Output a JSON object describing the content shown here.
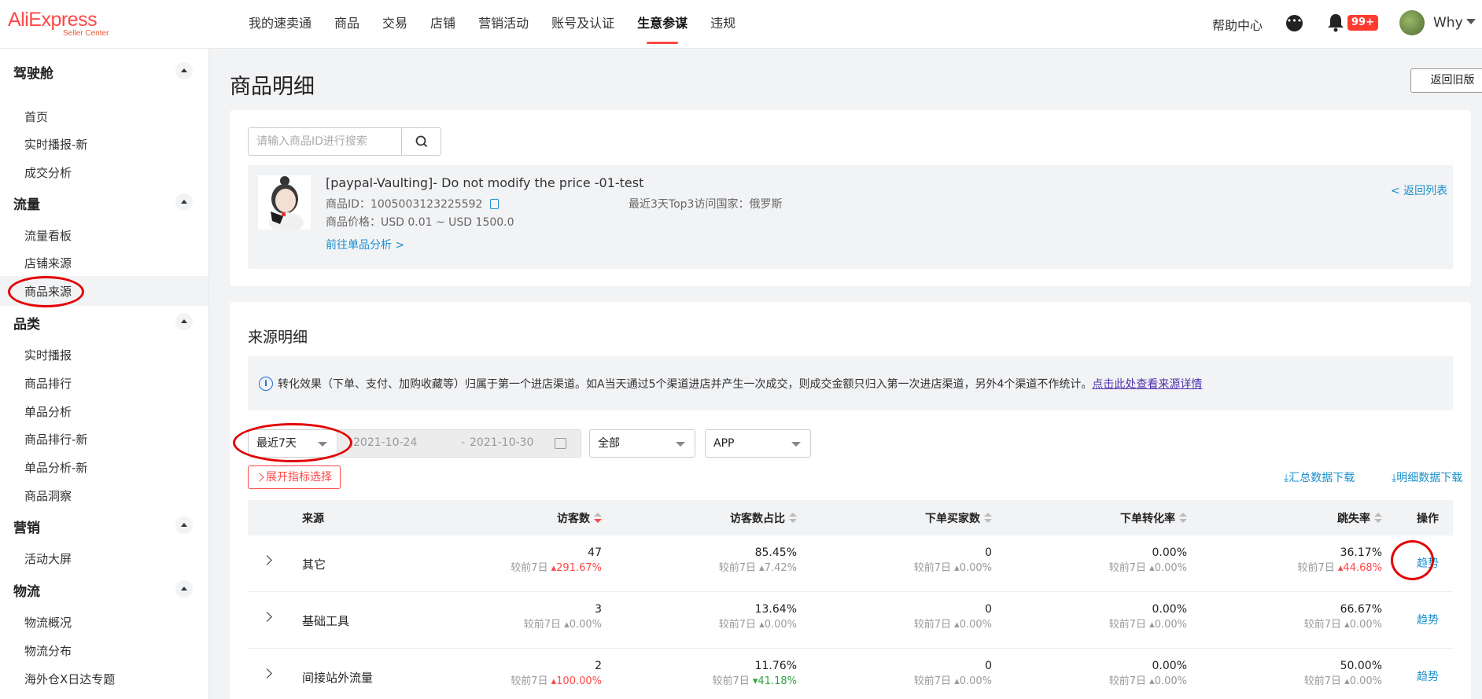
{
  "app": {
    "brand": "AliExpress",
    "sub": "Seller Center"
  },
  "nav": [
    "我的速卖通",
    "商品",
    "交易",
    "店铺",
    "营销活动",
    "账号及认证",
    "生意参谋",
    "违规"
  ],
  "nav_active": "生意参谋",
  "header": {
    "help": "帮助中心",
    "badge": "99+",
    "user": "Why"
  },
  "sidebar": {
    "sections": [
      {
        "title": "驾驶舱",
        "items": [
          "首页",
          "实时播报-新",
          "成交分析"
        ]
      },
      {
        "title": "流量",
        "items": [
          "流量看板",
          "店铺来源",
          "商品来源"
        ]
      },
      {
        "title": "品类",
        "items": [
          "实时播报",
          "商品排行",
          "单品分析",
          "商品排行-新",
          "单品分析-新",
          "商品洞察"
        ]
      },
      {
        "title": "营销",
        "items": [
          "活动大屏"
        ]
      },
      {
        "title": "物流",
        "items": [
          "物流概况",
          "物流分布",
          "海外仓X日达专题"
        ]
      }
    ],
    "selected": "商品来源"
  },
  "page": {
    "title": "商品明细",
    "old_version": "返回旧版"
  },
  "search": {
    "placeholder": "请输入商品ID进行搜索"
  },
  "product": {
    "name": "[paypal-Vaulting]- Do not modify the price -01-test",
    "id": "商品ID：1005003123225592",
    "price": "商品价格：USD 0.01 ~ USD 1500.0",
    "link": "前往单品分析 >",
    "top_countries": "最近3天Top3访问国家：俄罗斯",
    "back": "< 返回列表"
  },
  "source": {
    "title": "来源明细",
    "notice_text": "转化效果（下单、支付、加购收藏等）归属于第一个进店渠道。如A当天通过5个渠道进店并产生一次成交，则成交金额只归入第一次进店渠道，另外4个渠道不作统计。",
    "notice_link": "点击此处查看来源详情",
    "period": "最近7天",
    "date_start": "2021-10-24",
    "date_end": "2021-10-30",
    "date_sep": "-",
    "filter_all": "全部",
    "filter_app": "APP",
    "expand": "展开指标选择",
    "dl_summary": "汇总数据下载",
    "dl_detail": "明细数据下载"
  },
  "table": {
    "headers": [
      "来源",
      "访客数",
      "访客数占比",
      "下单买家数",
      "下单转化率",
      "跳失率",
      "操作"
    ],
    "compare_label": "较前7日",
    "action": "趋势",
    "rows": [
      {
        "name": "其它",
        "cells": [
          {
            "v": "47",
            "c": "291.67%",
            "d": "up"
          },
          {
            "v": "85.45%",
            "c": "7.42%",
            "d": "flat"
          },
          {
            "v": "0",
            "c": "0.00%",
            "d": "flat"
          },
          {
            "v": "0.00%",
            "c": "0.00%",
            "d": "flat"
          },
          {
            "v": "36.17%",
            "c": "44.68%",
            "d": "up"
          }
        ]
      },
      {
        "name": "基础工具",
        "cells": [
          {
            "v": "3",
            "c": "0.00%",
            "d": "flat"
          },
          {
            "v": "13.64%",
            "c": "0.00%",
            "d": "flat"
          },
          {
            "v": "0",
            "c": "0.00%",
            "d": "flat"
          },
          {
            "v": "0.00%",
            "c": "0.00%",
            "d": "flat"
          },
          {
            "v": "66.67%",
            "c": "0.00%",
            "d": "flat"
          }
        ]
      },
      {
        "name": "间接站外流量",
        "cells": [
          {
            "v": "2",
            "c": "100.00%",
            "d": "up"
          },
          {
            "v": "11.76%",
            "c": "41.18%",
            "d": "dn"
          },
          {
            "v": "0",
            "c": "0.00%",
            "d": "flat"
          },
          {
            "v": "0.00%",
            "c": "0.00%",
            "d": "flat"
          },
          {
            "v": "50.00%",
            "c": "0.00%",
            "d": "flat"
          }
        ]
      }
    ]
  },
  "colors": {
    "brand": "#ff4747",
    "link": "#1a8fcc",
    "annotation": "#e30000"
  }
}
